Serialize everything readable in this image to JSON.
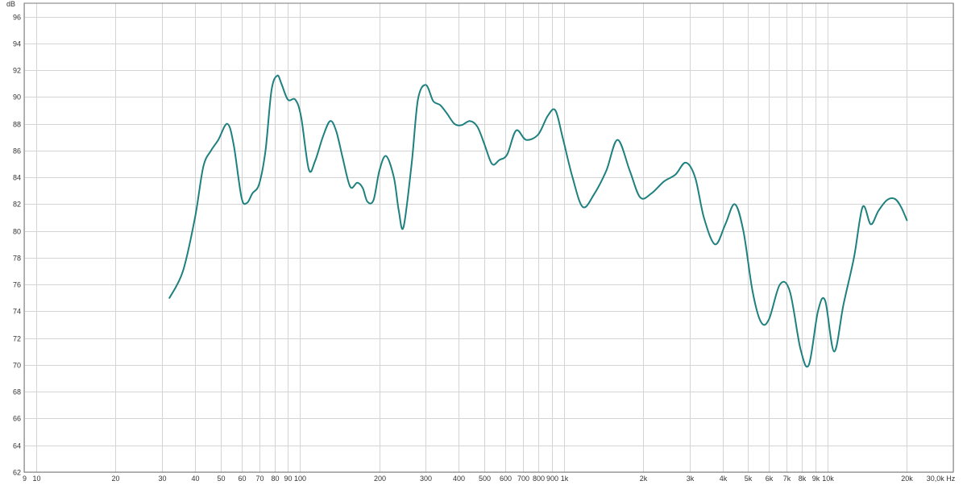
{
  "chart_data": {
    "type": "line",
    "title": "",
    "xlabel": "",
    "ylabel": "",
    "y_unit": "dB",
    "x_unit": "Hz",
    "x_scale": "log",
    "xlim": [
      9,
      30000
    ],
    "ylim": [
      62,
      97
    ],
    "grid": true,
    "colors": {
      "line": "#1f8080",
      "grid": "#d4d4d4",
      "axis": "#7a7a7a",
      "text": "#333333",
      "background": "#ffffff"
    },
    "x_ticks": [
      {
        "value": 9,
        "label": "9"
      },
      {
        "value": 10,
        "label": "10"
      },
      {
        "value": 20,
        "label": "20"
      },
      {
        "value": 30,
        "label": "30"
      },
      {
        "value": 40,
        "label": "40"
      },
      {
        "value": 50,
        "label": "50"
      },
      {
        "value": 60,
        "label": "60"
      },
      {
        "value": 70,
        "label": "70"
      },
      {
        "value": 80,
        "label": "80"
      },
      {
        "value": 90,
        "label": "90"
      },
      {
        "value": 100,
        "label": "100"
      },
      {
        "value": 200,
        "label": "200"
      },
      {
        "value": 300,
        "label": "300"
      },
      {
        "value": 400,
        "label": "400"
      },
      {
        "value": 500,
        "label": "500"
      },
      {
        "value": 600,
        "label": "600"
      },
      {
        "value": 700,
        "label": "700"
      },
      {
        "value": 800,
        "label": "800"
      },
      {
        "value": 900,
        "label": "900"
      },
      {
        "value": 1000,
        "label": "1k"
      },
      {
        "value": 2000,
        "label": "2k"
      },
      {
        "value": 3000,
        "label": "3k"
      },
      {
        "value": 4000,
        "label": "4k"
      },
      {
        "value": 5000,
        "label": "5k"
      },
      {
        "value": 6000,
        "label": "6k"
      },
      {
        "value": 7000,
        "label": "7k"
      },
      {
        "value": 8000,
        "label": "8k"
      },
      {
        "value": 9000,
        "label": "9k"
      },
      {
        "value": 10000,
        "label": "10k"
      },
      {
        "value": 20000,
        "label": "20k"
      },
      {
        "value": 30000,
        "label": "30,0k Hz"
      }
    ],
    "y_ticks": [
      62,
      64,
      66,
      68,
      70,
      72,
      74,
      76,
      78,
      80,
      82,
      84,
      86,
      88,
      90,
      92,
      94,
      96
    ],
    "series": [
      {
        "color": "#1f8080",
        "x": [
          32,
          36,
          40,
          43,
          46,
          49,
          53,
          56,
          60,
          63,
          66,
          70,
          74,
          78,
          82,
          85,
          90,
          96,
          101,
          108,
          114,
          122,
          130,
          137,
          145,
          155,
          165,
          173,
          180,
          190,
          200,
          212,
          227,
          237,
          247,
          265,
          280,
          300,
          320,
          340,
          360,
          385,
          410,
          440,
          470,
          500,
          535,
          570,
          610,
          660,
          720,
          800,
          870,
          930,
          990,
          1080,
          1180,
          1300,
          1450,
          1600,
          1780,
          1950,
          2150,
          2400,
          2650,
          2900,
          3150,
          3400,
          3750,
          4100,
          4450,
          4800,
          5200,
          5600,
          6000,
          6600,
          7200,
          7900,
          8500,
          9200,
          9800,
          10600,
          11500,
          12600,
          13600,
          14600,
          15600,
          16800,
          18000,
          19000,
          20000
        ],
        "y": [
          75.0,
          77.0,
          81.0,
          84.8,
          86.0,
          86.8,
          88.0,
          86.5,
          82.5,
          82.1,
          82.8,
          83.5,
          86.0,
          90.5,
          91.6,
          91.0,
          89.8,
          89.8,
          88.5,
          84.6,
          85.2,
          87.0,
          88.2,
          87.5,
          85.5,
          83.3,
          83.6,
          83.2,
          82.2,
          82.3,
          84.5,
          85.6,
          84.0,
          81.5,
          80.3,
          85.0,
          89.8,
          90.9,
          89.7,
          89.4,
          88.8,
          88.0,
          87.9,
          88.2,
          87.8,
          86.5,
          85.0,
          85.3,
          85.7,
          87.5,
          86.8,
          87.2,
          88.6,
          89.0,
          87.0,
          84.0,
          81.8,
          82.7,
          84.5,
          86.8,
          84.5,
          82.5,
          82.8,
          83.7,
          84.2,
          85.1,
          84.0,
          81.0,
          79.0,
          80.5,
          82.0,
          80.0,
          75.5,
          73.2,
          73.4,
          76.0,
          75.5,
          71.2,
          70.0,
          74.0,
          74.8,
          71.0,
          74.5,
          78.0,
          81.8,
          80.5,
          81.5,
          82.3,
          82.4,
          81.8,
          80.8
        ]
      }
    ]
  }
}
